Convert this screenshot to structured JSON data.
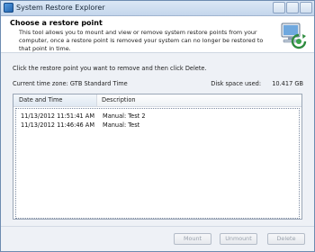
{
  "window": {
    "title": "System Restore Explorer",
    "icon": "app-icon"
  },
  "header": {
    "title": "Choose a restore point",
    "description": "This tool allows you to mount and view or remove system restore points from your computer, once a restore point is removed your system can no longer be restored to that point in time.",
    "graphic": "computer-restore-icon"
  },
  "main": {
    "instruction": "Click the restore point you want to remove and then click Delete.",
    "timezone_label": "Current time zone:",
    "timezone_value": "GTB Standard Time",
    "disk_label": "Disk space used:",
    "disk_value": "10.417 GB"
  },
  "table": {
    "columns": [
      "Date and Time",
      "Description"
    ],
    "rows": [
      {
        "datetime": "11/13/2012 11:51:41 AM",
        "description": "Manual: Test 2"
      },
      {
        "datetime": "11/13/2012 11:46:46 AM",
        "description": "Manual: Test"
      }
    ]
  },
  "buttons": {
    "mount": "Mount",
    "unmount": "Unmount",
    "delete": "Delete"
  },
  "colors": {
    "titlebar": "#c4d6ec",
    "window_bg": "#eef1f6",
    "disabled_text": "#9aa2ad"
  }
}
